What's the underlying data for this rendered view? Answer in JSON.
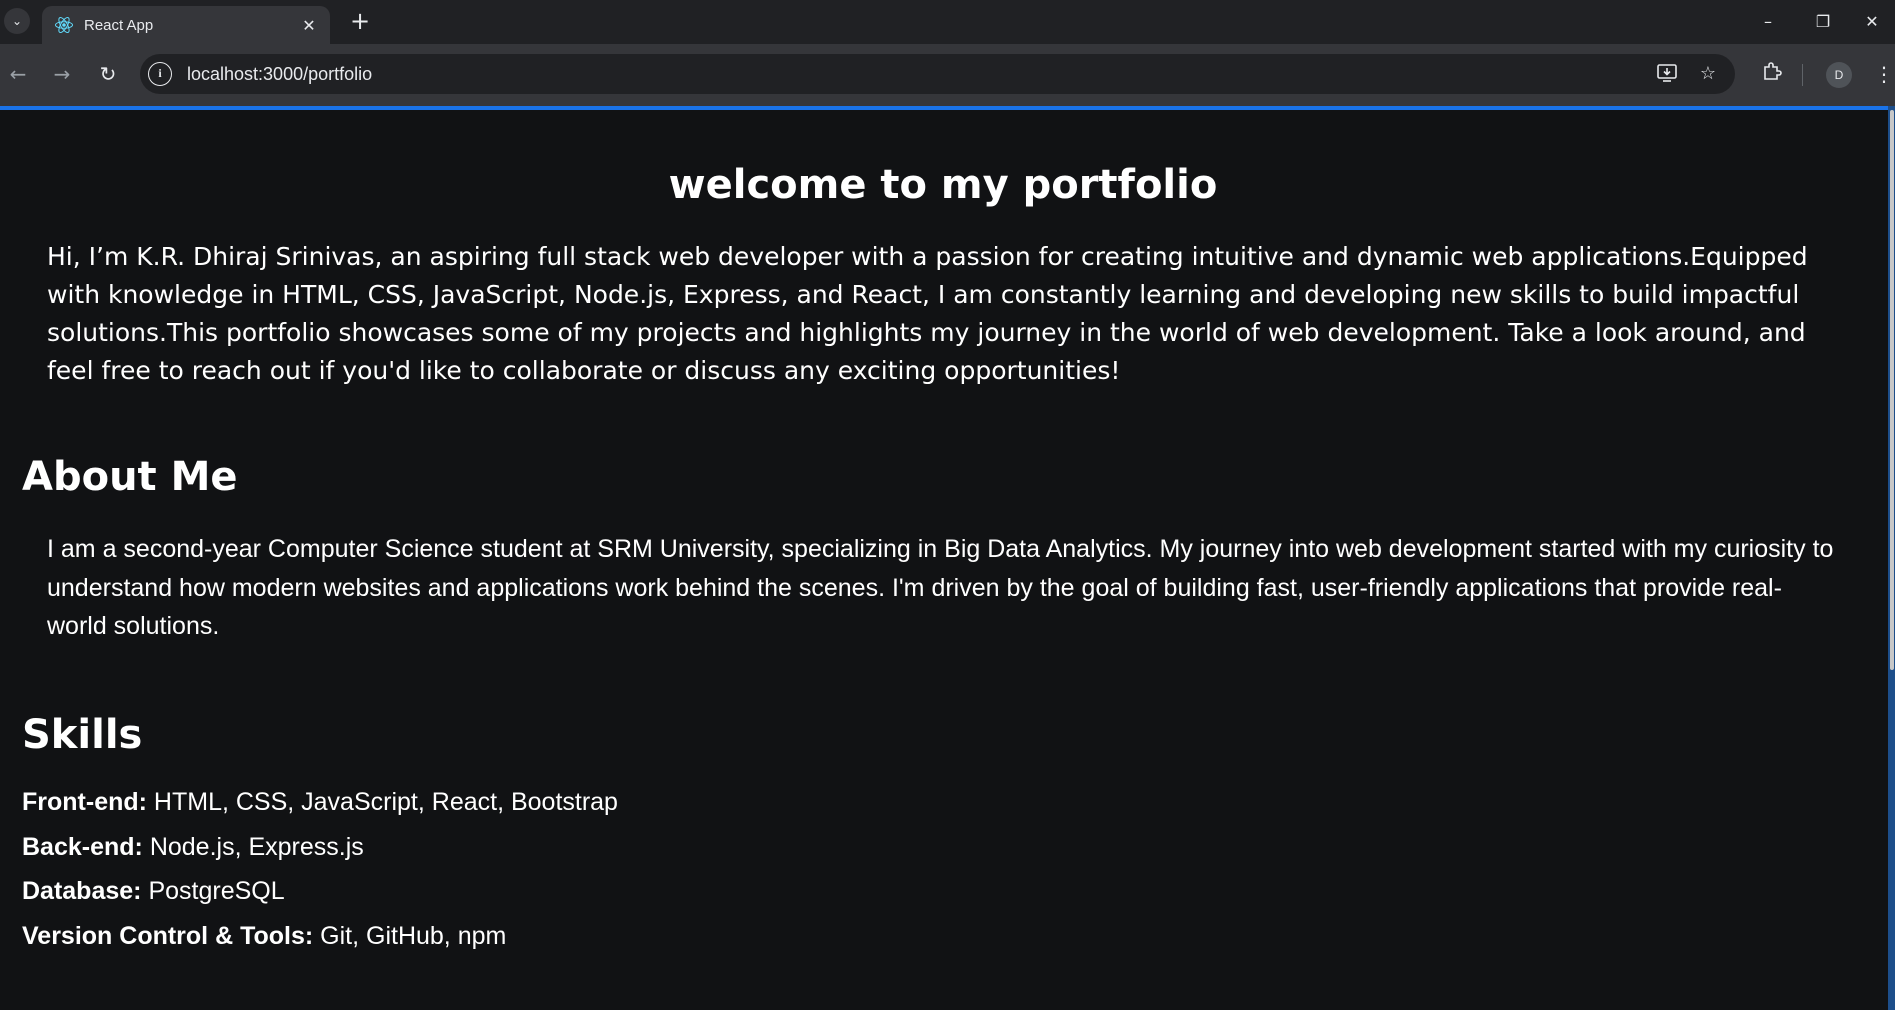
{
  "browser": {
    "tab_title": "React App",
    "url": "localhost:3000/portfolio",
    "profile_initial": "D",
    "icons": [
      "tab-search-icon",
      "react-logo-icon",
      "close-icon",
      "plus-icon",
      "minimize-icon",
      "restore-icon",
      "close-window-icon",
      "back-arrow-icon",
      "forward-arrow-icon",
      "reload-icon",
      "site-info-icon",
      "install-app-icon",
      "bookmark-star-icon",
      "extensions-icon",
      "kebab-menu-icon"
    ],
    "accent_color": "#1a73e8"
  },
  "hero": {
    "title": "welcome to my portfolio",
    "intro": "Hi, I’m K.R. Dhiraj Srinivas, an aspiring full stack web developer with a passion for creating intuitive and dynamic web applications.Equipped with knowledge in HTML, CSS, JavaScript, Node.js, Express, and React, I am constantly learning and developing new skills to build impactful solutions.This portfolio showcases some of my projects and highlights my journey in the world of web development. Take a look around, and feel free to reach out if you'd like to collaborate or discuss any exciting opportunities!"
  },
  "about": {
    "heading": "About Me",
    "text": "I am a second-year Computer Science student at SRM University, specializing in Big Data Analytics. My journey into web development started with my curiosity to understand how modern websites and applications work behind the scenes. I'm driven by the goal of building fast, user-friendly applications that provide real-world solutions."
  },
  "skills": {
    "heading": "Skills",
    "items": [
      {
        "label": "Front-end:",
        "value": " HTML, CSS, JavaScript, React, Bootstrap"
      },
      {
        "label": "Back-end:",
        "value": " Node.js, Express.js"
      },
      {
        "label": "Database:",
        "value": " PostgreSQL"
      },
      {
        "label": "Version Control & Tools:",
        "value": " Git, GitHub, npm"
      }
    ]
  },
  "colors": {
    "page_background": "#111214",
    "text": "#ffffff"
  }
}
